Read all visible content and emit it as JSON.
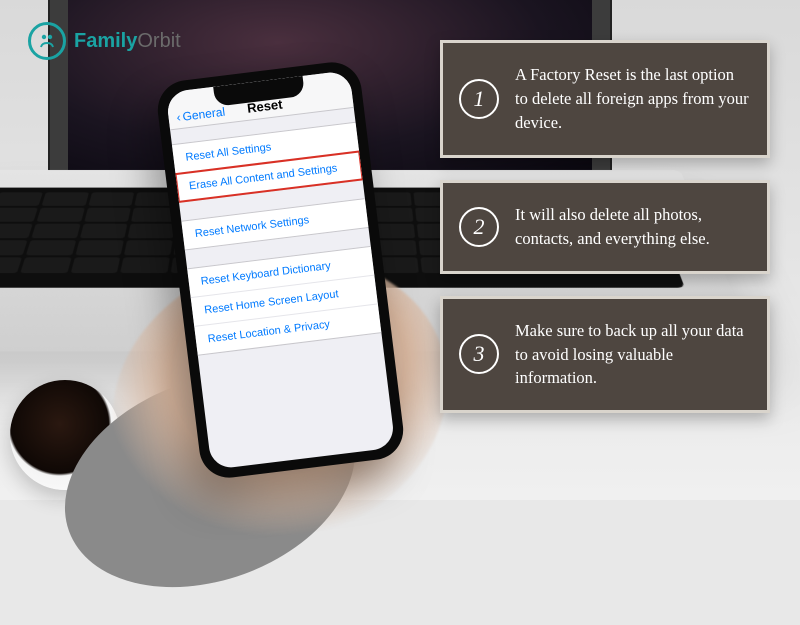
{
  "logo": {
    "brand_a": "Family",
    "brand_b": "Orbit"
  },
  "phone": {
    "back_label": "General",
    "title": "Reset",
    "groups": [
      {
        "rows": [
          "Reset All Settings",
          "Erase All Content and Settings"
        ],
        "highlight_index": 1
      },
      {
        "rows": [
          "Reset Network Settings"
        ]
      },
      {
        "rows": [
          "Reset Keyboard Dictionary",
          "Reset Home Screen Layout",
          "Reset Location & Privacy"
        ]
      }
    ]
  },
  "callouts": [
    {
      "n": "1",
      "text": "A Factory Reset is the last option to delete all foreign apps from your device."
    },
    {
      "n": "2",
      "text": "It will also delete all photos, contacts, and everything else."
    },
    {
      "n": "3",
      "text": "Make sure to back up all your data to avoid losing valuable information."
    }
  ]
}
